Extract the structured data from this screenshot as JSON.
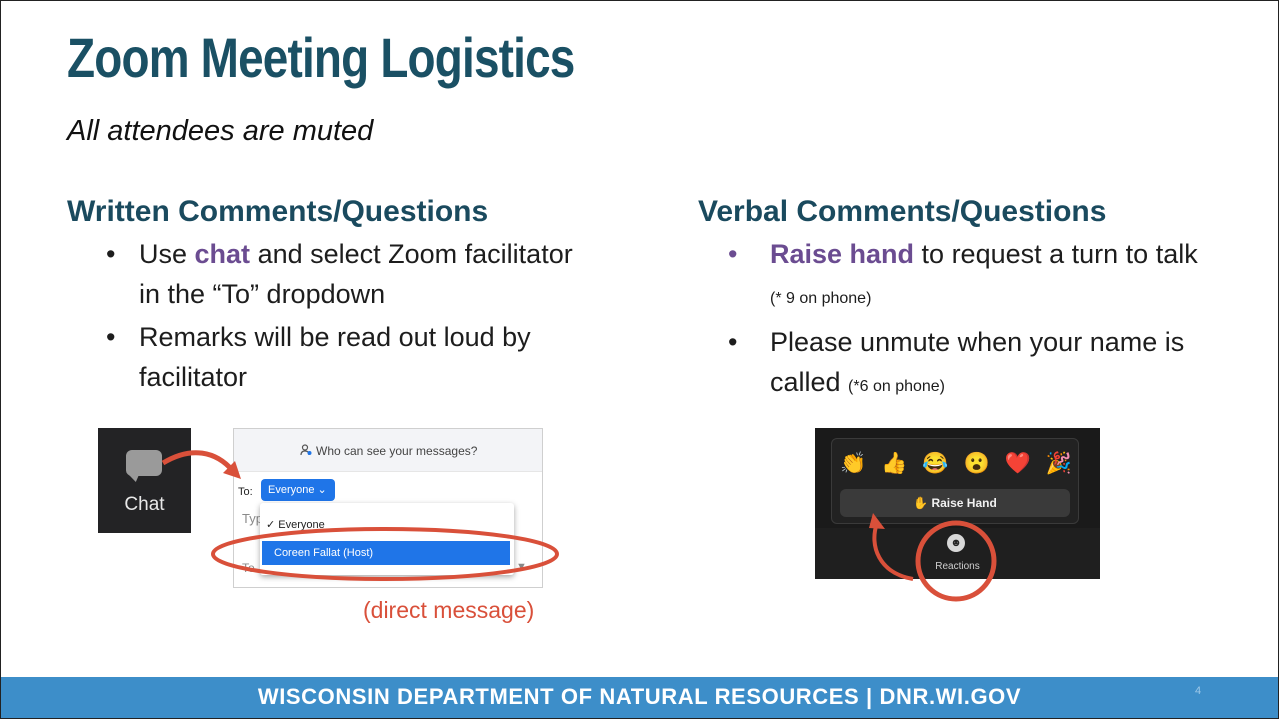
{
  "title": "Zoom Meeting Logistics",
  "subtitle": "All attendees are muted",
  "left": {
    "heading": "Written Comments/Questions",
    "bullet1_highlight": "chat",
    "bullet1_pre": "Use ",
    "bullet1_post": " and select Zoom facilitator in the “To” dropdown",
    "bullet2": "Remarks will be read out loud by facilitator"
  },
  "right": {
    "heading": "Verbal Comments/Questions",
    "bullet1_highlight": "Raise hand",
    "bullet1_post": " to request a turn to talk ",
    "bullet1_note": "(* 9 on phone)",
    "bullet2": "Please unmute when your name is called ",
    "bullet2_note": "(*6 on phone)"
  },
  "chat_screenshot": {
    "button_label": "Chat",
    "who_can_see": "Who can see your messages?",
    "to_label": "To:",
    "to_value": "Everyone",
    "type_hint": "Typ",
    "option_everyone": "✓ Everyone",
    "option_host": "Coreen Fallat (Host)",
    "bottom_hint": "To",
    "annotation": "(direct message)"
  },
  "reactions_screenshot": {
    "emojis": [
      "👏",
      "👍",
      "😂",
      "😮",
      "❤️",
      "🎉"
    ],
    "raise_hand_label": "✋ Raise Hand",
    "reactions_label": "Reactions"
  },
  "footer": {
    "text": "WISCONSIN DEPARTMENT OF NATURAL RESOURCES | DNR.WI.GOV",
    "page_number": "4"
  },
  "colors": {
    "title": "#1a5064",
    "accent": "#6b4c91",
    "annotation": "#d9503a",
    "footer": "#3d8ec9"
  }
}
